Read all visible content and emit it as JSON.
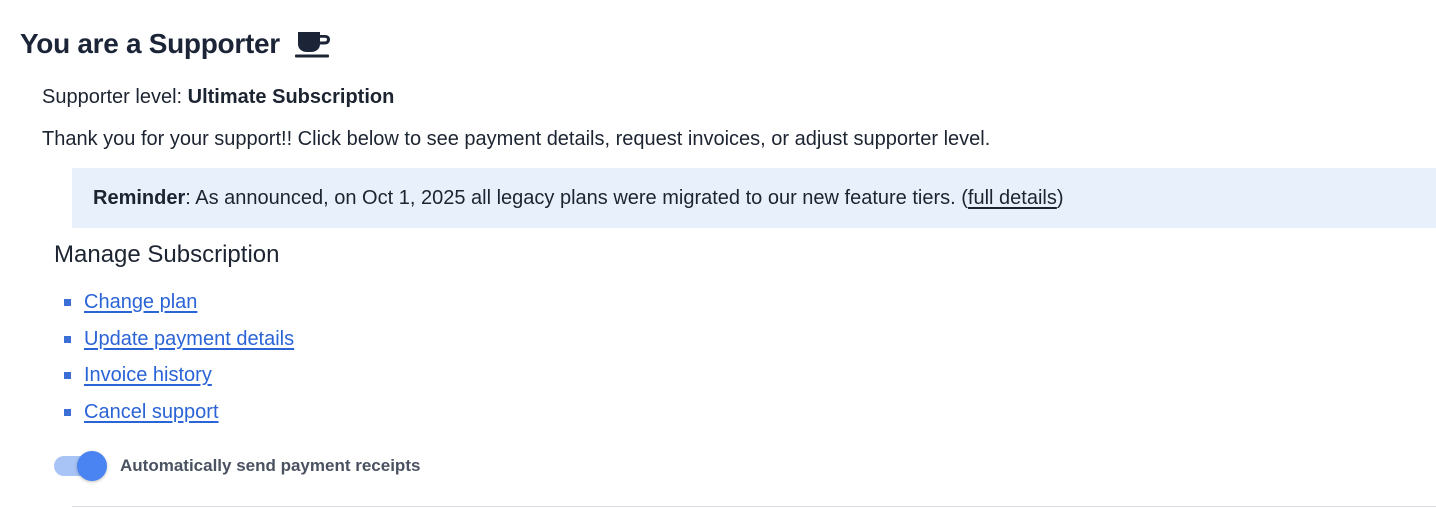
{
  "header": {
    "title": "You are a Supporter",
    "icon": "coffee-cup-icon"
  },
  "supporter": {
    "level_label": "Supporter level: ",
    "level_value": "Ultimate Subscription",
    "thanks_text": "Thank you for your support!! Click below to see payment details, request invoices, or adjust supporter level."
  },
  "reminder": {
    "label": "Reminder",
    "text": ": As announced, on Oct 1, 2025 all legacy plans were migrated to our new feature tiers. (",
    "link_text": "full details",
    "close_paren": ")",
    "background": "#e8f0fc"
  },
  "manage": {
    "title": "Manage Subscription",
    "links": [
      {
        "label": "Change plan"
      },
      {
        "label": "Update payment details"
      },
      {
        "label": "Invoice history"
      },
      {
        "label": "Cancel support"
      }
    ],
    "link_color": "#2a64d6"
  },
  "receipts_toggle": {
    "label": "Automatically send payment receipts",
    "enabled": true,
    "accent": "#4a84f2"
  }
}
